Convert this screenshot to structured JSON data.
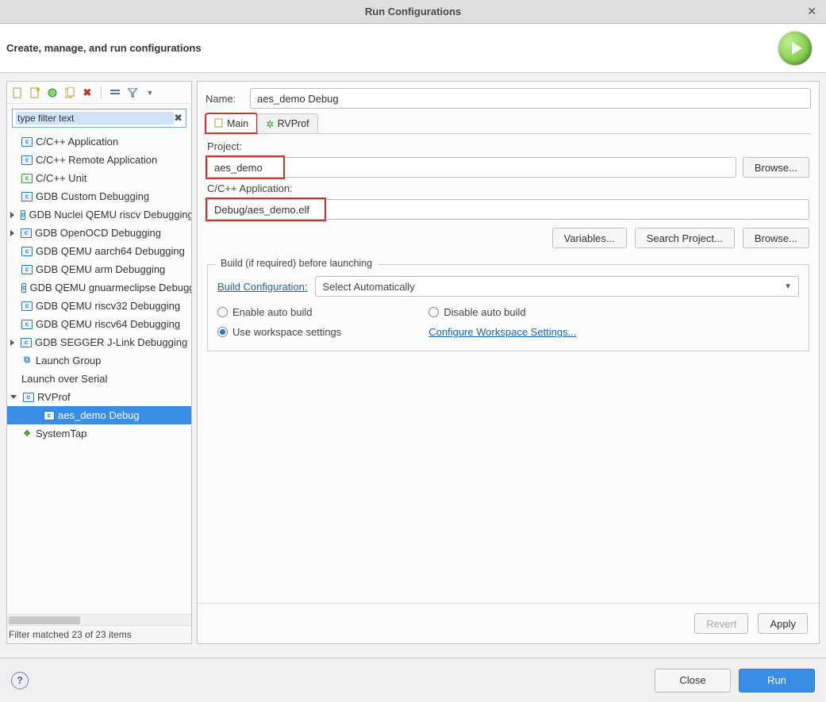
{
  "window": {
    "title": "Run Configurations"
  },
  "header": {
    "title": "Create, manage, and run configurations"
  },
  "filter": {
    "placeholder": "type filter text"
  },
  "configs": [
    {
      "label": "C/C++ Application"
    },
    {
      "label": "C/C++ Remote Application"
    },
    {
      "label": "C/C++ Unit",
      "ico": "green"
    },
    {
      "label": "GDB Custom Debugging"
    },
    {
      "label": "GDB Nuclei QEMU riscv Debugging",
      "expander": "exp"
    },
    {
      "label": "GDB OpenOCD Debugging",
      "expander": "exp"
    },
    {
      "label": "GDB QEMU aarch64 Debugging"
    },
    {
      "label": "GDB QEMU arm Debugging"
    },
    {
      "label": "GDB QEMU gnuarmeclipse Debugging (Deprecated)"
    },
    {
      "label": "GDB QEMU riscv32 Debugging"
    },
    {
      "label": "GDB QEMU riscv64 Debugging"
    },
    {
      "label": "GDB SEGGER J-Link Debugging",
      "expander": "exp"
    },
    {
      "label": "Launch Group",
      "ico": "launch"
    },
    {
      "label": "Launch over Serial",
      "noico": true
    },
    {
      "label": "RVProf",
      "expander": "col",
      "expanded": true,
      "children": [
        {
          "label": "aes_demo Debug",
          "selected": true
        }
      ]
    },
    {
      "label": "SystemTap",
      "ico": "stap"
    }
  ],
  "leftStatus": "Filter matched 23 of 23 items",
  "form": {
    "nameLabel": "Name:",
    "name": "aes_demo Debug",
    "tabs": {
      "main": "Main",
      "rvprof": "RVProf"
    },
    "projectLabel": "Project:",
    "project": "aes_demo",
    "browse": "Browse...",
    "appLabel": "C/C++ Application:",
    "app": "Debug/aes_demo.elf",
    "variables": "Variables...",
    "searchProject": "Search Project...",
    "buildLegend": "Build (if required) before launching",
    "buildConfigLabel": "Build Configuration:",
    "buildConfigValue": "Select Automatically",
    "radios": {
      "enableAuto": "Enable auto build",
      "disableAuto": "Disable auto build",
      "useWorkspace": "Use workspace settings",
      "configureWs": "Configure Workspace Settings..."
    },
    "revert": "Revert",
    "apply": "Apply"
  },
  "footer": {
    "close": "Close",
    "run": "Run"
  }
}
